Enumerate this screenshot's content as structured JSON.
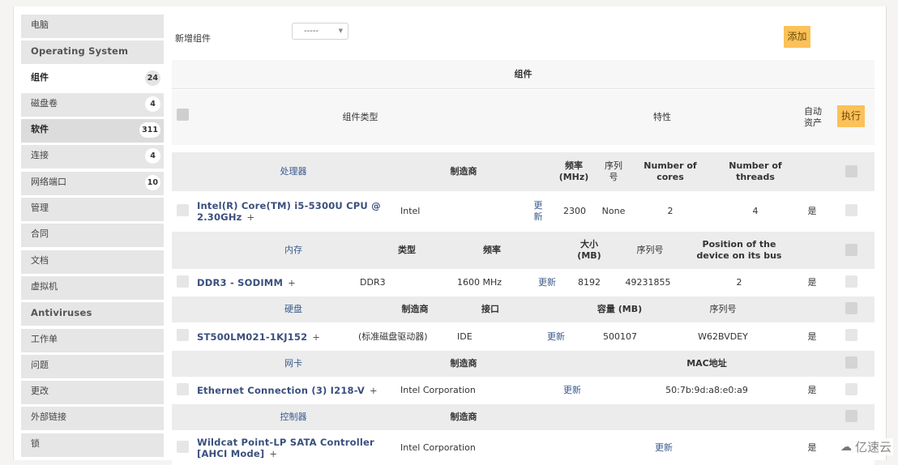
{
  "sidebar": {
    "items": [
      {
        "label": "电脑",
        "badge": null
      },
      {
        "label": "Operating System",
        "badge": null
      },
      {
        "label": "组件",
        "badge": "24"
      },
      {
        "label": "磁盘卷",
        "badge": "4"
      },
      {
        "label": "软件",
        "badge": "311"
      },
      {
        "label": "连接",
        "badge": "4"
      },
      {
        "label": "网络端口",
        "badge": "10"
      },
      {
        "label": "管理",
        "badge": null
      },
      {
        "label": "合同",
        "badge": null
      },
      {
        "label": "文档",
        "badge": null
      },
      {
        "label": "虚拟机",
        "badge": null
      },
      {
        "label": "Antiviruses",
        "badge": null
      },
      {
        "label": "工作单",
        "badge": null
      },
      {
        "label": "问题",
        "badge": null
      },
      {
        "label": "更改",
        "badge": null
      },
      {
        "label": "外部链接",
        "badge": null
      },
      {
        "label": "锁",
        "badge": null
      }
    ]
  },
  "toolbar": {
    "add_component_label": "新增组件",
    "select_value": "-----",
    "add_button": "添加"
  },
  "table": {
    "title": "组件",
    "col_type": "组件类型",
    "col_features": "特性",
    "col_auto": "自动\n资产",
    "exec_button": "执行",
    "update_label": "更新",
    "yes": "是",
    "sections": [
      {
        "type": "处理器",
        "headers": [
          "制造商",
          "频率\n(MHz)",
          "序列\n号",
          "Number of\ncores",
          "Number of\nthreads"
        ],
        "row": {
          "name": "Intel(R) Core(TM) i5-5300U CPU @ 2.30GHz",
          "values": [
            "Intel",
            "更\n新",
            "2300",
            "None",
            "2",
            "4"
          ],
          "auto": "是"
        }
      },
      {
        "type": "内存",
        "headers": [
          "类型",
          "频率",
          "大小\n(MB)",
          "序列号",
          "Position of the\ndevice on its bus"
        ],
        "row": {
          "name": "DDR3 - SODIMM",
          "values": [
            "DDR3",
            "1600 MHz",
            "更新",
            "8192",
            "49231855",
            "2"
          ],
          "auto": "是"
        }
      },
      {
        "type": "硬盘",
        "headers": [
          "制造商",
          "接口",
          "容量 (MB)",
          "序列号"
        ],
        "row": {
          "name": "ST500LM021-1KJ152",
          "values": [
            "(标准磁盘驱动器)",
            "IDE",
            "更新",
            "500107",
            "W62BVDEY"
          ],
          "auto": "是"
        }
      },
      {
        "type": "网卡",
        "headers": [
          "制造商",
          "MAC地址"
        ],
        "row": {
          "name": "Ethernet Connection (3) I218-V",
          "values": [
            "Intel Corporation",
            "更新",
            "50:7b:9d:a8:e0:a9"
          ],
          "auto": "是"
        }
      },
      {
        "type": "控制器",
        "headers": [
          "制造商"
        ],
        "row": {
          "name": "Wildcat Point-LP SATA Controller [AHCI Mode]",
          "values": [
            "Intel Corporation",
            "更新"
          ],
          "auto": "是"
        }
      }
    ]
  },
  "watermark": {
    "text": "亿速云"
  }
}
